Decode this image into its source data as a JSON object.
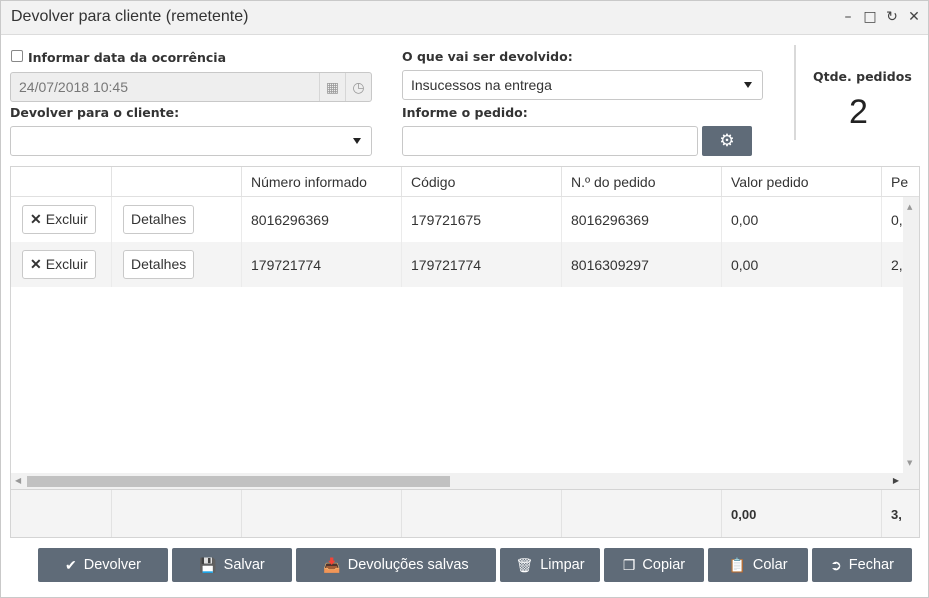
{
  "window": {
    "title": "Devolver para cliente (remetente)",
    "controls": [
      "minimize-icon",
      "maximize-icon",
      "refresh-icon",
      "close-icon"
    ]
  },
  "form": {
    "informar_data_label": "Informar data da ocorrência",
    "informar_data_checked": false,
    "date_value": "24/07/2018 10:45",
    "devolver_cliente_label": "Devolver para o cliente:",
    "devolver_cliente_value": "",
    "oque_devolvido_label": "O que vai ser devolvido:",
    "oque_devolvido_value": "Insucessos na entrega",
    "informe_pedido_label": "Informe o pedido:",
    "informe_pedido_value": ""
  },
  "summary": {
    "qtde_label": "Qtde. pedidos",
    "qtde_value": "2"
  },
  "grid": {
    "columns": [
      "",
      "",
      "Número informado",
      "Código",
      "N.º do pedido",
      "Valor pedido",
      "Pe"
    ],
    "row_actions": {
      "excluir": "Excluir",
      "detalhes": "Detalhes"
    },
    "rows": [
      {
        "numero_informado": "8016296369",
        "codigo": "179721675",
        "numero_pedido": "8016296369",
        "valor_pedido": "0,00",
        "pe": "0,"
      },
      {
        "numero_informado": "179721774",
        "codigo": "179721774",
        "numero_pedido": "8016309297",
        "valor_pedido": "0,00",
        "pe": "2,"
      }
    ],
    "totals": {
      "valor_pedido": "0,00",
      "pe": "3,"
    }
  },
  "actions": {
    "devolver": "Devolver",
    "salvar": "Salvar",
    "devolucoes_salvas": "Devoluções salvas",
    "limpar": "Limpar",
    "copiar": "Copiar",
    "colar": "Colar",
    "fechar": "Fechar"
  }
}
